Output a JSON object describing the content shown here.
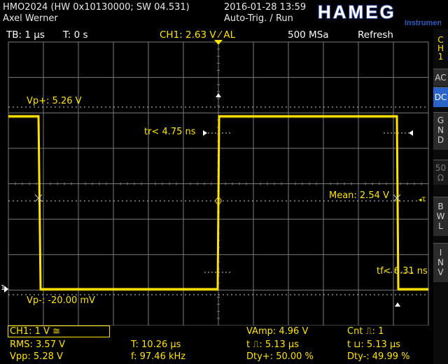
{
  "header": {
    "device": "HMO2024 (HW 0x10130000; SW 04.531)",
    "user": "Axel Werner",
    "datetime": "2016-01-28 13:59",
    "trigger_mode": "Auto-Trig. / Run",
    "brand": "HAMEG",
    "brand_sub": "Instruments"
  },
  "topbar": {
    "timebase": "TB: 1 µs",
    "trigger_time": "T: 0 s",
    "channel_setting": "CH1: 2.63 V ⁄ AL",
    "sample_rate": "500 MSa",
    "mode": "Refresh"
  },
  "sidebar": {
    "channel": [
      "C",
      "H",
      "1"
    ],
    "buttons": [
      {
        "label": "AC",
        "state": "normal"
      },
      {
        "label": "DC",
        "state": "active"
      },
      {
        "label": "G\nN\nD",
        "state": "normal"
      },
      {
        "label": "50\nΩ",
        "state": "dim"
      },
      {
        "label": "B\nW\nL",
        "state": "normal"
      },
      {
        "label": "I\nN\nV",
        "state": "normal"
      }
    ]
  },
  "screen_labels": {
    "vp_plus": "Vp+: 5.26 V",
    "vp_minus": "Vp-: -20.00 mV",
    "rise_time": "tr< 4.75 ns",
    "fall_time": "tf< 6.31 ns",
    "mean": "Mean: 2.54 V",
    "ch_marker": "1",
    "trigger_marker": "◂T"
  },
  "measurements": {
    "channel": "CH1: 1 V ≅",
    "rms": "RMS: 3.57 V",
    "vpp": "Vpp: 5.28 V",
    "period": "T: 10.26 µs",
    "frequency": "f: 97.46 kHz",
    "vamp": "VAmp: 4.96 V",
    "pos_width": "t ⎍: 5.13 µs",
    "pos_duty": "Dty+: 50.00 %",
    "count": "Cnt ⎍: 1",
    "neg_width": "t ⊔: 5.13 µs",
    "neg_duty": "Dty-: 49.99 %"
  },
  "colors": {
    "trace": "#ffe400",
    "grid": "#7a7a7a",
    "accent": "#2a64c8",
    "brand": "#1f3c8c"
  }
}
